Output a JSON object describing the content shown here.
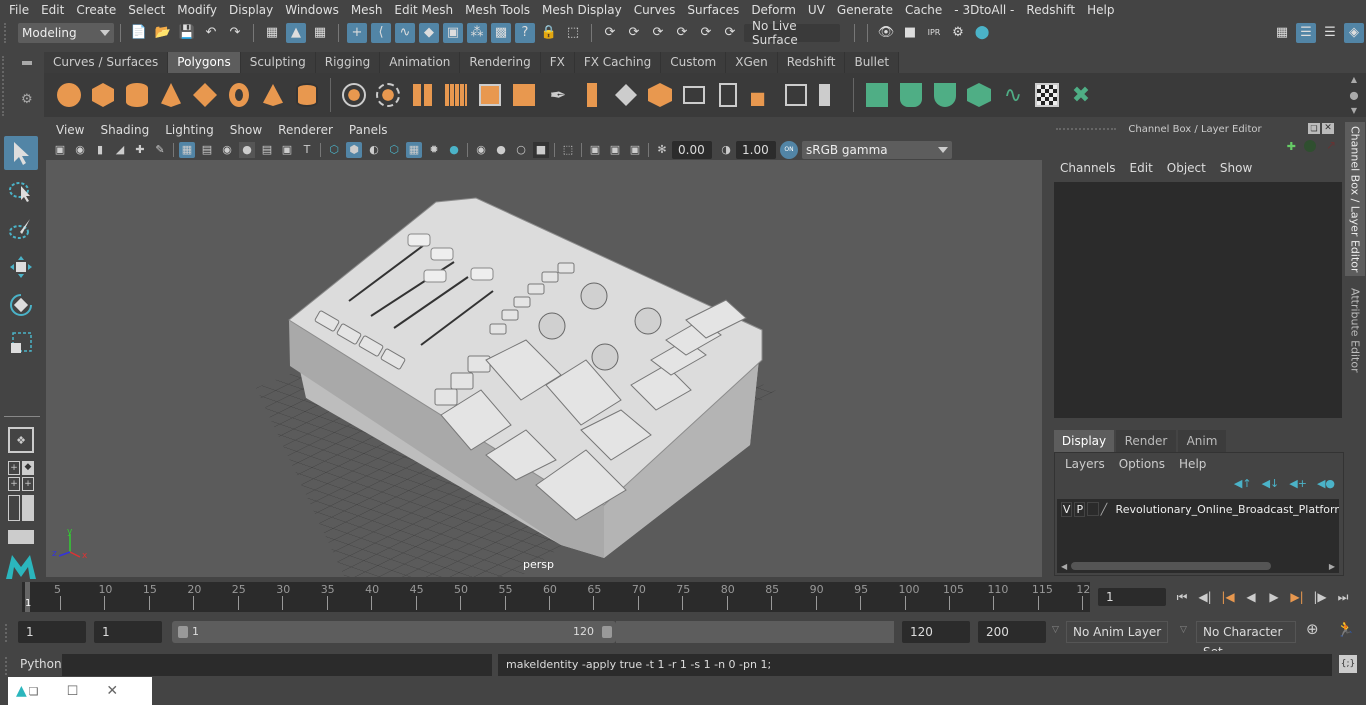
{
  "menubar": [
    "File",
    "Edit",
    "Create",
    "Select",
    "Modify",
    "Display",
    "Windows",
    "Mesh",
    "Edit Mesh",
    "Mesh Tools",
    "Mesh Display",
    "Curves",
    "Surfaces",
    "Deform",
    "UV",
    "Generate",
    "Cache",
    "- 3DtoAll -",
    "Redshift",
    "Help"
  ],
  "statusline": {
    "workspace": "Modeling",
    "live_surface": "No Live Surface"
  },
  "shelf": {
    "tabs": [
      "Curves / Surfaces",
      "Polygons",
      "Sculpting",
      "Rigging",
      "Animation",
      "Rendering",
      "FX",
      "FX Caching",
      "Custom",
      "XGen",
      "Redshift",
      "Bullet"
    ],
    "active_tab": "Polygons",
    "poly_icons": [
      "poly-sphere-icon",
      "poly-cube-icon",
      "poly-cylinder-icon",
      "poly-cone-icon",
      "poly-plane-icon",
      "poly-torus-icon",
      "poly-pyramid-icon",
      "poly-pipe-icon"
    ],
    "edit_icons": [
      "combine-icon",
      "separate-icon",
      "mirror-icon",
      "smooth-icon",
      "reduce-icon",
      "cleanup-icon",
      "multi-cut-icon",
      "extrude-icon",
      "bridge-icon",
      "bevel-icon",
      "fill-hole-icon",
      "insert-edge-loop-icon",
      "offset-edge-loop-icon",
      "append-polygon-icon",
      "merge-icon",
      "quadrangulate-icon"
    ],
    "uv_icons": [
      "planar-mapping-icon",
      "cylindrical-mapping-icon",
      "spherical-mapping-icon",
      "automatic-mapping-icon",
      "unfold-icon",
      "uv-editor-icon",
      "layout-uv-icon"
    ]
  },
  "viewport": {
    "menu": [
      "View",
      "Shading",
      "Lighting",
      "Show",
      "Renderer",
      "Panels"
    ],
    "exposure": "0.00",
    "gamma": "1.00",
    "color_mgmt_toggle": "ON",
    "color_space": "sRGB gamma",
    "camera_label": "persp",
    "axis": {
      "x": "x",
      "y": "y",
      "z": "z"
    }
  },
  "channel_box": {
    "title": "Channel Box / Layer Editor",
    "menu": [
      "Channels",
      "Edit",
      "Object",
      "Show"
    ]
  },
  "layer_editor": {
    "tabs": [
      "Display",
      "Render",
      "Anim"
    ],
    "active_tab": "Display",
    "menu": [
      "Layers",
      "Options",
      "Help"
    ],
    "layers": [
      {
        "v": "V",
        "p": "P",
        "name": "Revolutionary_Online_Broadcast_Platform_V"
      }
    ]
  },
  "side_tabs": [
    "Channel Box / Layer Editor",
    "Attribute Editor"
  ],
  "timeline": {
    "ticks": [
      "5",
      "10",
      "15",
      "20",
      "25",
      "30",
      "35",
      "40",
      "45",
      "50",
      "55",
      "60",
      "65",
      "70",
      "75",
      "80",
      "85",
      "90",
      "95",
      "100",
      "105",
      "110",
      "115",
      "12"
    ],
    "current_frame_marker": "1",
    "current_frame": "1"
  },
  "range": {
    "start": "1",
    "playback_start": "1",
    "slider_min": "1",
    "slider_max": "120",
    "playback_end": "120",
    "end": "200",
    "anim_layer": "No Anim Layer",
    "character_set": "No Character Set"
  },
  "command_line": {
    "language": "Python",
    "input": "",
    "result": "makeIdentity -apply true -t 1 -r 1 -s 1 -n 0 -pn 1;"
  }
}
